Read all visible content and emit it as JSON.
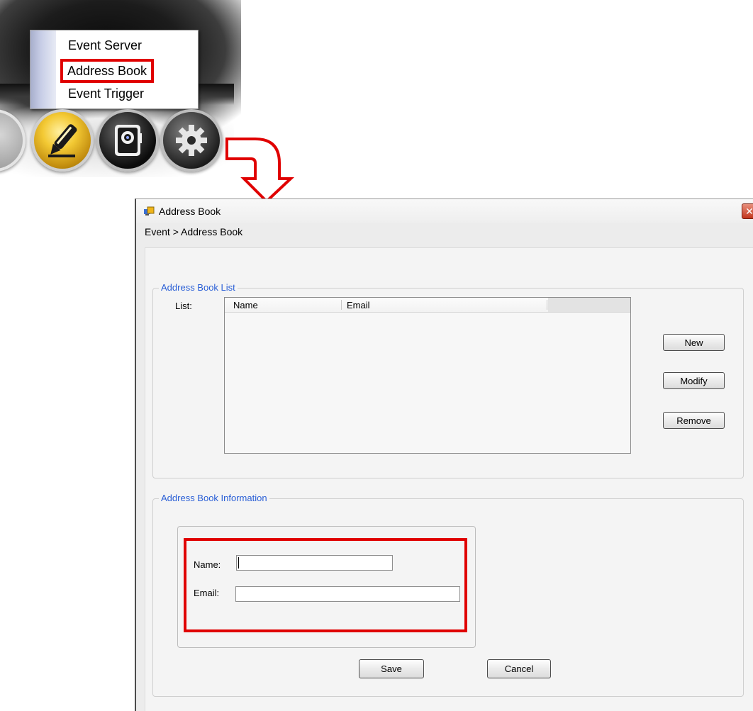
{
  "popup_menu": {
    "items": [
      {
        "label": "Event Server"
      },
      {
        "label": "Address Book",
        "highlighted": true
      },
      {
        "label": "Event Trigger"
      }
    ]
  },
  "toolbar": {
    "buttons": [
      {
        "icon": "pencil-icon",
        "active": true
      },
      {
        "icon": "camera-icon"
      },
      {
        "icon": "gear-icon"
      }
    ]
  },
  "dialog": {
    "title": "Address Book",
    "breadcrumb": "Event > Address Book",
    "list_group": {
      "legend": "Address Book List",
      "list_label": "List:",
      "columns": [
        "Name",
        "Email"
      ],
      "rows": [],
      "buttons": {
        "new": "New",
        "modify": "Modify",
        "remove": "Remove"
      }
    },
    "info_group": {
      "legend": "Address Book Information",
      "name_label": "Name:",
      "name_value": "",
      "email_label": "Email:",
      "email_value": ""
    },
    "footer": {
      "save": "Save",
      "cancel": "Cancel"
    }
  },
  "colors": {
    "highlight_red": "#e00000",
    "legend_blue": "#2a5fd6",
    "pencil_gold": "#f3c934"
  }
}
